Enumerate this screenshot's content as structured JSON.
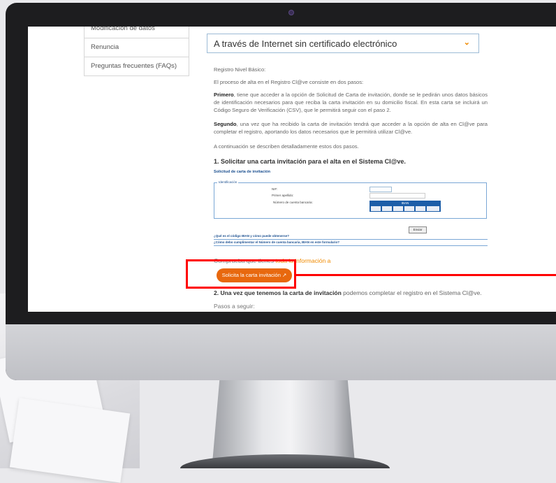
{
  "sidebar": {
    "items": [
      {
        "label": "Modificación de datos"
      },
      {
        "label": "Renuncia"
      },
      {
        "label": "Preguntas frecuentes (FAQs)"
      }
    ]
  },
  "accordion": {
    "title": "A través de Internet sin certificado electrónico"
  },
  "content": {
    "p_level": "Registro Nivel Básico:",
    "p_intro": "El proceso de alta en el Registro Cl@ve consiste en dos pasos:",
    "p_first_bold": "Primero",
    "p_first": ", tiene que acceder a la opción de Solicitud de Carta de invitación, donde se le pedirán unos datos básicos de identificación necesarios para que reciba la carta invitación en su domicilio fiscal. En esta carta se incluirá un Código Seguro de Verificación (CSV), que le permitirá seguir con el paso 2.",
    "p_second_bold": "Segundo",
    "p_second": ", una vez que ha recibido la carta de invitación tendrá que acceder a la opción de alta en Cl@ve para completar el registro, aportando los datos necesarios que le permitirá utilizar Cl@ve.",
    "p_detail": "A continuación se describen detalladamente estos dos pasos.",
    "h1": "1. Solicitar una carta invitación para el alta en el Sistema Cl@ve.",
    "p_check": "Comprueba que tienes",
    "p_check_link": "toda la información a",
    "cta_label": "Solicita la carta invitación",
    "p_step2_bold": "2. Una vez que tenemos la carta de invitación",
    "p_step2": " podemos completar el registro en el Sistema Cl@ve.",
    "p_steps": "Pasos a seguir:"
  },
  "form": {
    "title": "Solicitud de carta de invitación",
    "legend": "Identificación",
    "nif_label": "NIF:",
    "surname_label": "Primer apellido:",
    "account_label": "Número de cuenta bancaria:",
    "iban_label": "IBAN",
    "send_label": "Enviar",
    "link1": "¿Qué es el código IBAN y cómo puede obtenerse?",
    "link2": "¿Cómo debo cumplimentar el Número de cuenta bancaria, IBAN en este formulario?"
  },
  "colors": {
    "accent": "#e8680e",
    "highlight": "#ff0000",
    "link": "#1b4f8f"
  }
}
